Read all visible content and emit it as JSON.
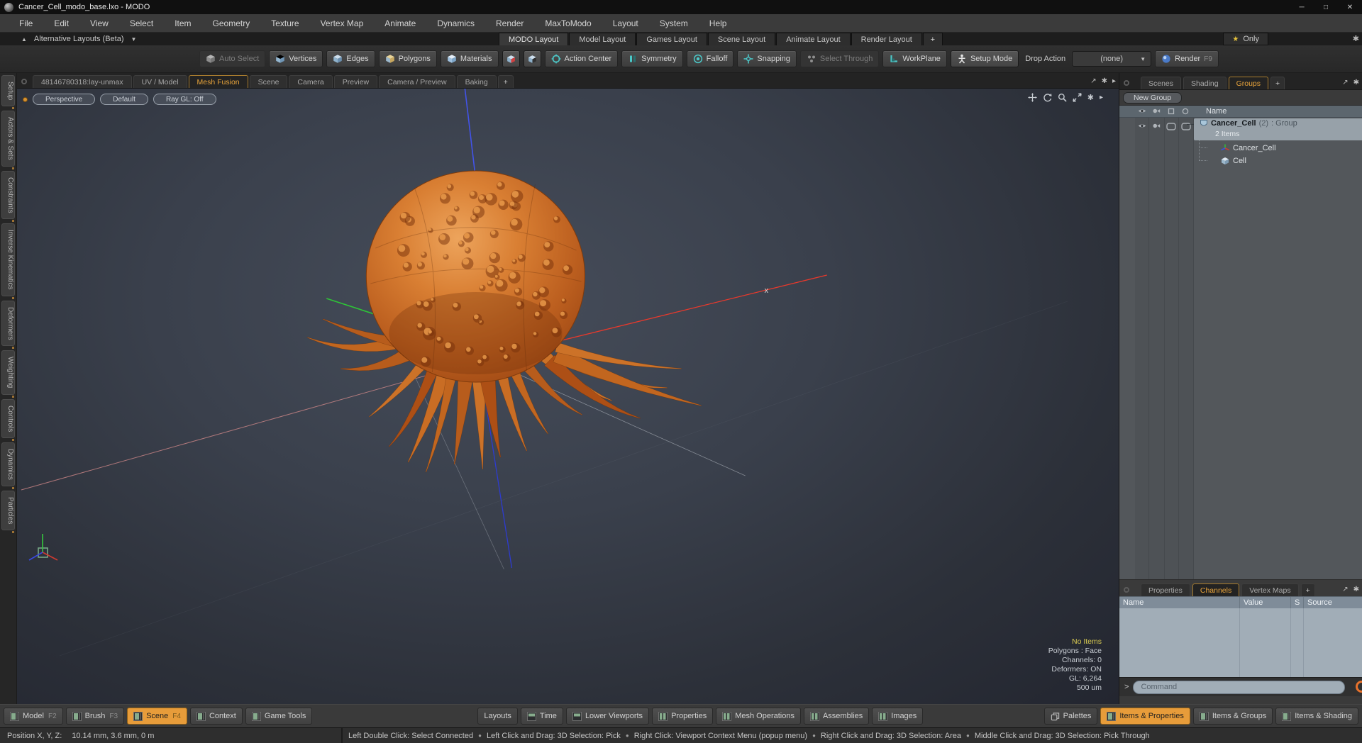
{
  "window": {
    "title": "Cancer_Cell_modo_base.lxo - MODO"
  },
  "menu": {
    "items": [
      "File",
      "Edit",
      "View",
      "Select",
      "Item",
      "Geometry",
      "Texture",
      "Vertex Map",
      "Animate",
      "Dynamics",
      "Render",
      "MaxToModo",
      "Layout",
      "System",
      "Help"
    ]
  },
  "layout_bar": {
    "alt_layouts": "Alternative Layouts (Beta)",
    "tabs": [
      "MODO Layout",
      "Model Layout",
      "Games Layout",
      "Scene Layout",
      "Animate Layout",
      "Render Layout"
    ],
    "add_tab": "+",
    "only_label": "Only"
  },
  "toolbar": {
    "auto_select": "Auto Select",
    "vertices": "Vertices",
    "edges": "Edges",
    "polygons": "Polygons",
    "materials": "Materials",
    "action_center": "Action Center",
    "symmetry": "Symmetry",
    "falloff": "Falloff",
    "snapping": "Snapping",
    "select_through": "Select Through",
    "workplane": "WorkPlane",
    "setup_mode": "Setup Mode",
    "drop_action": "Drop Action",
    "drop_action_value": "(none)",
    "render": "Render",
    "render_key": "F9"
  },
  "viewport": {
    "tabs": [
      "48146780318:lay-unmax",
      "UV / Model",
      "Mesh Fusion",
      "Scene",
      "Camera",
      "Preview",
      "Camera / Preview",
      "Baking"
    ],
    "add_tab": "+",
    "controls": {
      "projection": "Perspective",
      "shading": "Default",
      "raygl": "Ray GL: Off"
    },
    "info": [
      "No Items",
      "Polygons : Face",
      "Channels: 0",
      "Deformers: ON",
      "GL: 6,264",
      "500 um"
    ],
    "cursor": "x"
  },
  "left_tabs": [
    "Setup",
    "Actors & Sets",
    "Constraints",
    "Inverse Kinematics",
    "Deformers",
    "Weighting",
    "Controls",
    "Dynamics",
    "Particles"
  ],
  "groups_panel": {
    "tabs": [
      "Scenes",
      "Shading",
      "Groups"
    ],
    "add_tab": "+",
    "new_group": "New Group",
    "name_header": "Name",
    "group_name": "Cancer_Cell",
    "group_count": "(2)",
    "group_type": ": Group",
    "group_items": "2 Items",
    "child1": "Cancer_Cell",
    "child2": "Cell"
  },
  "channels_panel": {
    "tabs": [
      "Properties",
      "Channels",
      "Vertex Maps"
    ],
    "add_tab": "+",
    "headers": [
      "Name",
      "Value",
      "S",
      "Source"
    ],
    "prompt": ">",
    "command_placeholder": "Command"
  },
  "bottom_bar": {
    "left": [
      {
        "label": "Model",
        "key": "F2"
      },
      {
        "label": "Brush",
        "key": "F3"
      },
      {
        "label": "Scene",
        "key": "F4"
      },
      {
        "label": "Context",
        "key": ""
      },
      {
        "label": "Game Tools",
        "key": ""
      }
    ],
    "middle": [
      "Layouts",
      "Time",
      "Lower Viewports",
      "Properties",
      "Mesh Operations",
      "Assemblies",
      "Images"
    ],
    "right": [
      "Palettes",
      "Items & Properties",
      "Items & Groups",
      "Items & Shading"
    ]
  },
  "status_bar": {
    "position_label": "Position X, Y, Z:",
    "position_value": "10.14 mm, 3.6 mm, 0 m",
    "hints": [
      "Left Double Click: Select Connected",
      "Left Click and Drag: 3D Selection: Pick",
      "Right Click: Viewport Context Menu (popup menu)",
      "Right Click and Drag: 3D Selection: Area",
      "Middle Click and Drag: 3D Selection: Pick Through"
    ]
  },
  "colors": {
    "accent_orange": "#e79c3a",
    "teal": "#4cc8c8",
    "selection": "#97a1a9",
    "cell_orange": "#c96a2a",
    "viewport_bg": "#3a404c"
  }
}
